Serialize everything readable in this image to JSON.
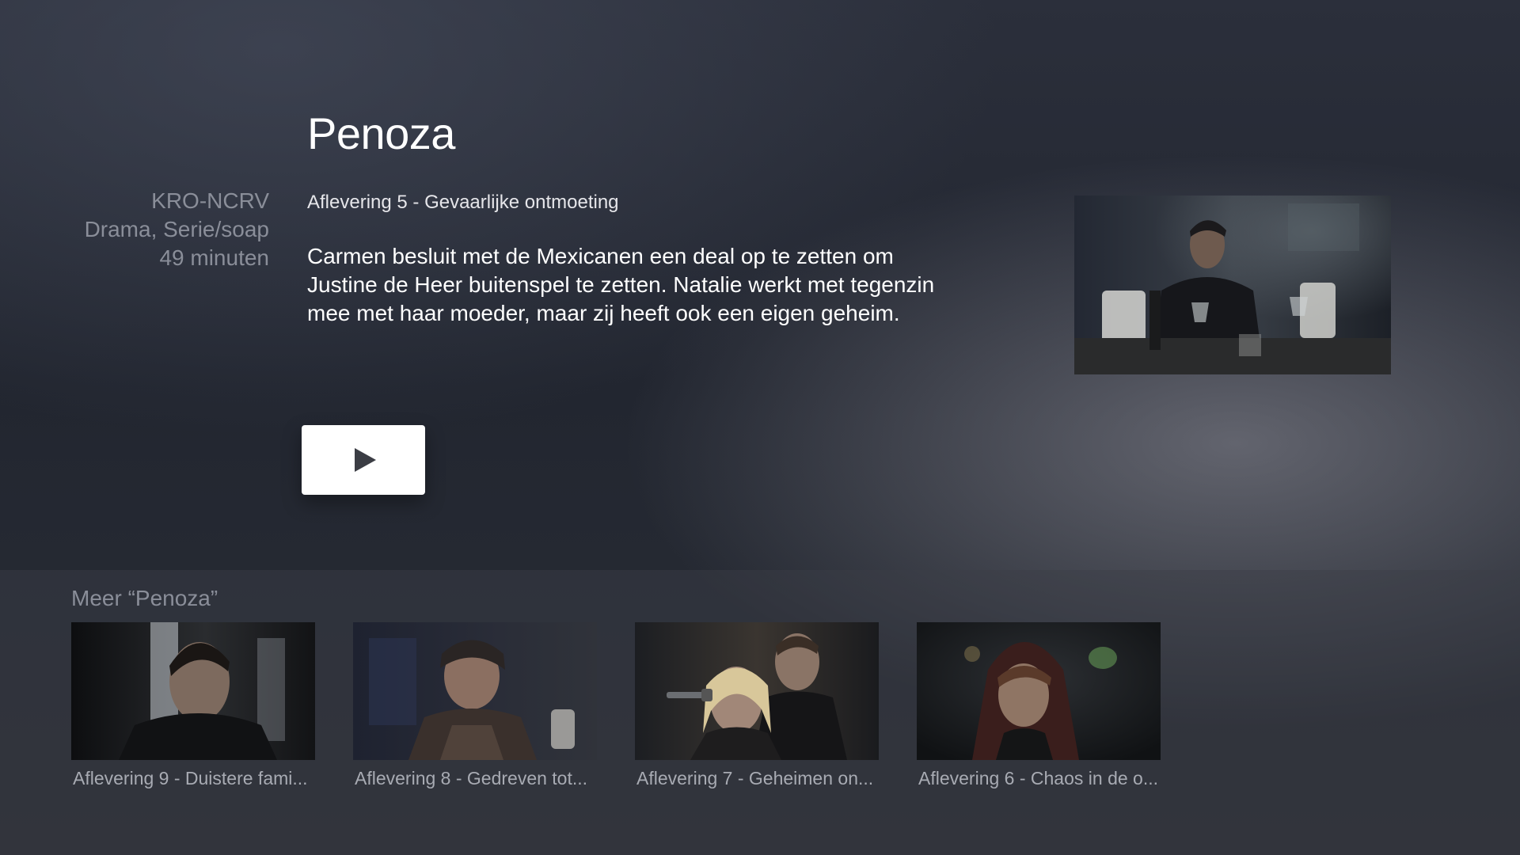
{
  "show": {
    "title": "Penoza",
    "broadcaster": "KRO-NCRV",
    "genre": "Drama, Serie/soap",
    "duration": "49 minuten",
    "episode_title": "Aflevering 5 - Gevaarlijke ontmoeting",
    "description": "Carmen besluit met de Mexicanen een deal op te zetten om Justine de Heer buitenspel te zetten. Natalie werkt met tegenzin mee met haar moeder, maar zij heeft ook een eigen geheim."
  },
  "play_button": {
    "icon": "play-icon"
  },
  "more": {
    "title": "Meer “Penoza”",
    "episodes": [
      {
        "label": "Aflevering 9 - Duistere fami..."
      },
      {
        "label": "Aflevering 8 - Gedreven tot..."
      },
      {
        "label": "Aflevering 7 - Geheimen on..."
      },
      {
        "label": "Aflevering 6 - Chaos in de o..."
      }
    ]
  },
  "colors": {
    "background": "#242833",
    "meta_text": "#8a8e99",
    "button": "#ffffff"
  }
}
